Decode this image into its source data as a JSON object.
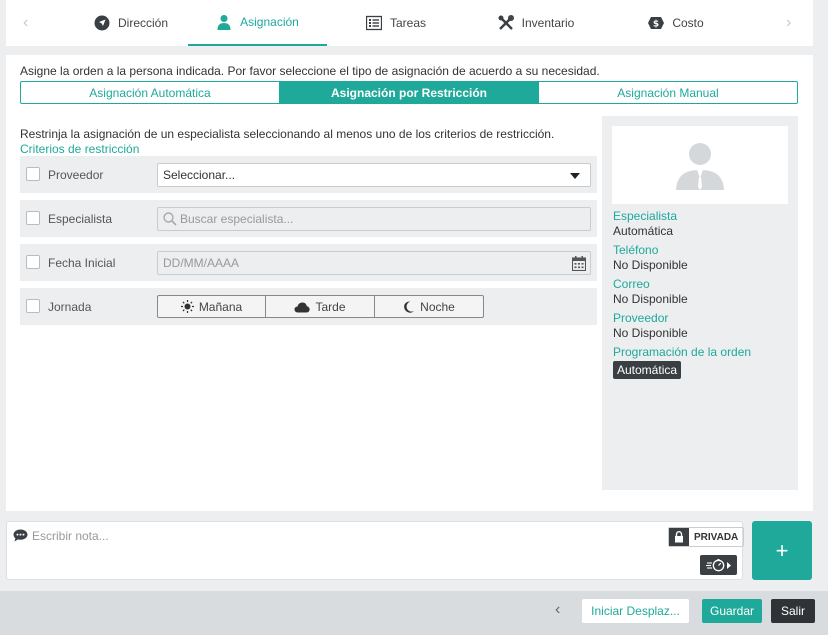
{
  "tabs": [
    {
      "label": "Dirección",
      "icon": "compass-icon"
    },
    {
      "label": "Asignación",
      "icon": "user-icon"
    },
    {
      "label": "Tareas",
      "icon": "list-icon"
    },
    {
      "label": "Inventario",
      "icon": "tools-icon"
    },
    {
      "label": "Costo",
      "icon": "money-icon"
    }
  ],
  "active_tab": "Asignación",
  "intro_text": "Asigne la orden a la persona indicada. Por favor seleccione el tipo de asignación de acuerdo a su necesidad.",
  "assignment_types": [
    "Asignación Automática",
    "Asignación por Restricción",
    "Asignación Manual"
  ],
  "active_assignment_type": "Asignación por Restricción",
  "restriction_text": "Restrinja la asignación de un especialista seleccionando al menos uno de los criterios de restricción.",
  "criteria_link": "Criterios de restricción",
  "criteria": {
    "provider": {
      "label": "Proveedor",
      "value": "Seleccionar..."
    },
    "specialist": {
      "label": "Especialista",
      "placeholder": "Buscar especialista..."
    },
    "start_date": {
      "label": "Fecha Inicial",
      "placeholder": "DD/MM/AAAA"
    },
    "shift": {
      "label": "Jornada",
      "options": [
        "Mañana",
        "Tarde",
        "Noche"
      ]
    }
  },
  "info": {
    "specialist_label": "Especialista",
    "specialist_value": "Automática",
    "phone_label": "Teléfono",
    "phone_value": "No Disponible",
    "email_label": "Correo",
    "email_value": "No Disponible",
    "provider_label": "Proveedor",
    "provider_value": "No Disponible",
    "schedule_label": "Programación de la orden",
    "schedule_value": "Automática"
  },
  "note": {
    "placeholder": "Escribir nota...",
    "private_label": "PRIVADA",
    "add_label": "+"
  },
  "footer": {
    "start_label": "Iniciar Desplaz...",
    "save_label": "Guardar",
    "exit_label": "Salir"
  },
  "colors": {
    "accent": "#1fa99a",
    "dark": "#3a3f44"
  }
}
